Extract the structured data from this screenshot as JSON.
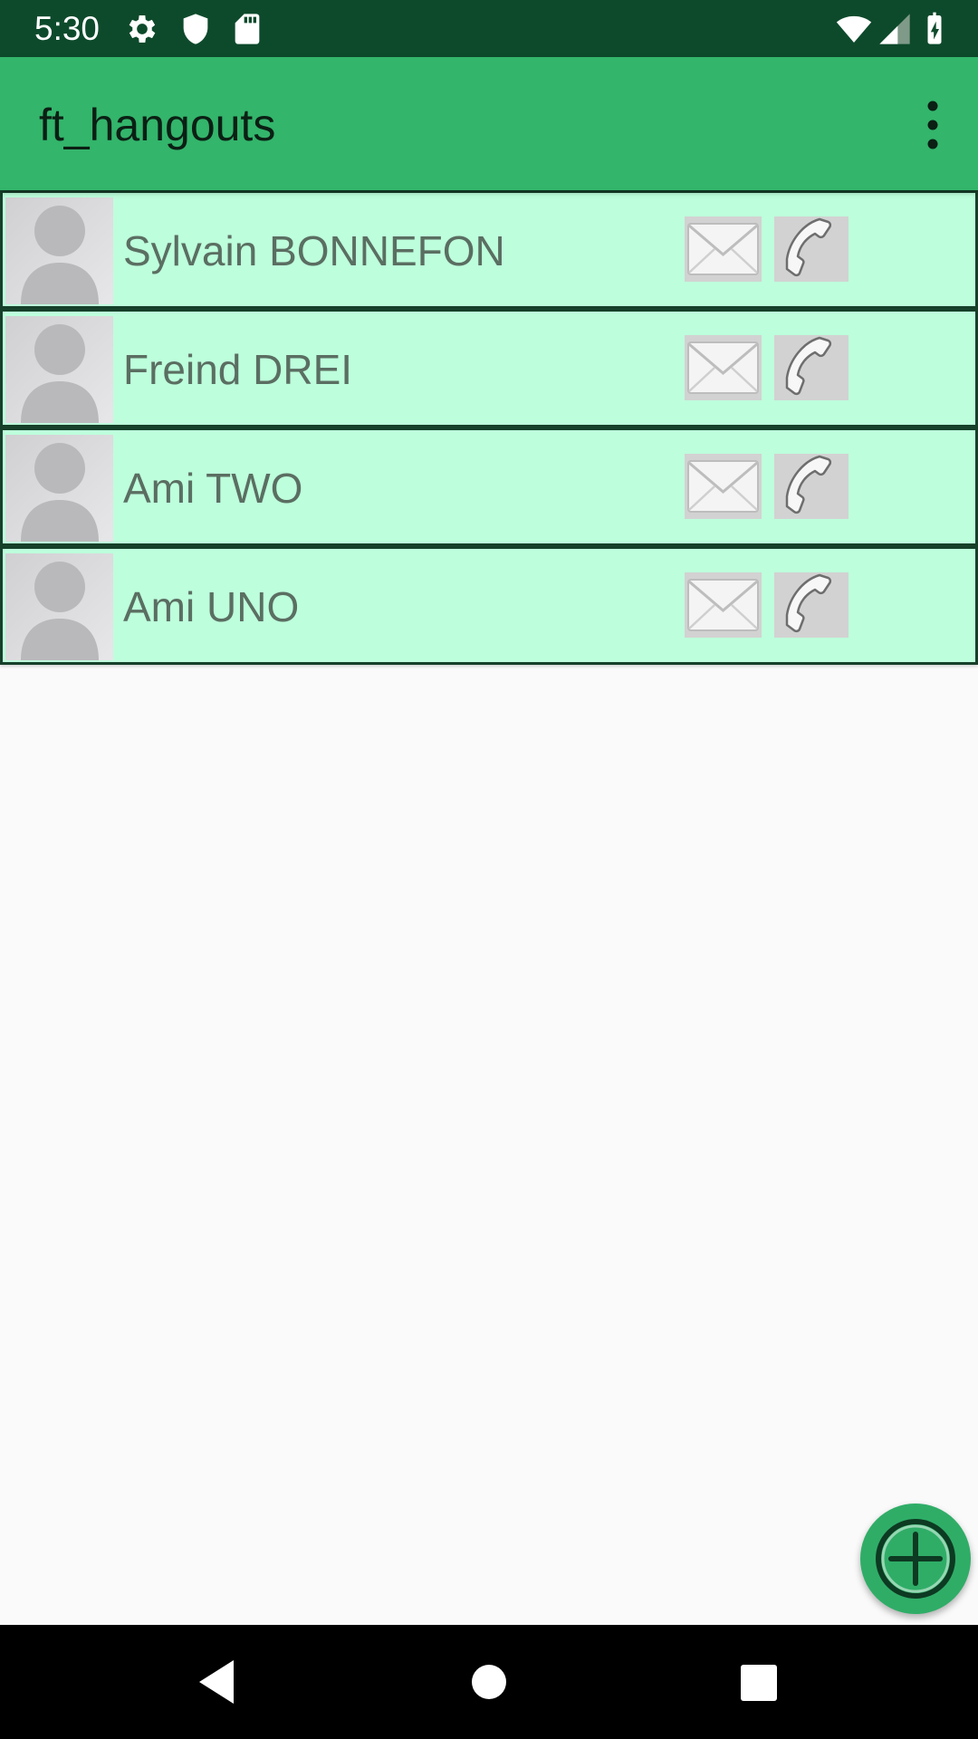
{
  "status_bar": {
    "time": "5:30",
    "left_icons": [
      "settings-icon",
      "shield-icon",
      "sd-card-icon"
    ],
    "right_icons": [
      "wifi-icon",
      "cell-signal-icon",
      "battery-charging-icon"
    ]
  },
  "app_bar": {
    "title": "ft_hangouts",
    "menu_icon": "more-vert-icon"
  },
  "contacts": [
    {
      "name": "Sylvain BONNEFON"
    },
    {
      "name": "Freind DREI"
    },
    {
      "name": "Ami TWO"
    },
    {
      "name": "Ami UNO"
    }
  ],
  "row_icons": {
    "avatar": "default-avatar-icon",
    "message": "envelope-icon",
    "call": "phone-icon"
  },
  "fab": {
    "icon": "add-circle-icon"
  },
  "nav_bar": {
    "icons": [
      "back-icon",
      "home-icon",
      "recents-icon"
    ]
  },
  "colors": {
    "status_bar": "#0d4a2b",
    "app_bar": "#33b56b",
    "row_background": "#bdffdc",
    "row_border": "#16402a",
    "fab": "#2fad67",
    "background": "#fafafa"
  }
}
